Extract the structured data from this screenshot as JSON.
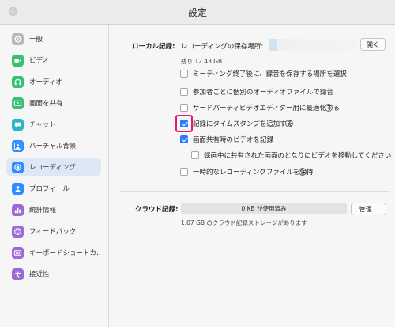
{
  "window": {
    "title": "設定"
  },
  "sidebar": {
    "items": [
      {
        "label": "一般",
        "icon": "gear-icon",
        "color": "#b9b9b9",
        "active": false
      },
      {
        "label": "ビデオ",
        "icon": "video-icon",
        "color": "#38c173",
        "active": false
      },
      {
        "label": "オーディオ",
        "icon": "headphones-icon",
        "color": "#38c173",
        "active": false
      },
      {
        "label": "画面を共有",
        "icon": "share-screen-icon",
        "color": "#38c173",
        "active": false
      },
      {
        "label": "チャット",
        "icon": "chat-icon",
        "color": "#2bb6c8",
        "active": false
      },
      {
        "label": "バーチャル背景",
        "icon": "person-background-icon",
        "color": "#2d8cff",
        "active": false
      },
      {
        "label": "レコーディング",
        "icon": "record-icon",
        "color": "#2d8cff",
        "active": true
      },
      {
        "label": "プロフィール",
        "icon": "profile-icon",
        "color": "#2d8cff",
        "active": false
      },
      {
        "label": "統計情報",
        "icon": "stats-icon",
        "color": "#9b6ad6",
        "active": false
      },
      {
        "label": "フィードバック",
        "icon": "feedback-icon",
        "color": "#9b6ad6",
        "active": false
      },
      {
        "label": "キーボードショートカ…",
        "icon": "keyboard-icon",
        "color": "#9b6ad6",
        "active": false
      },
      {
        "label": "接近性",
        "icon": "accessibility-icon",
        "color": "#9b6ad6",
        "active": false
      }
    ]
  },
  "local": {
    "label": "ローカル記録:",
    "location_label": "レコーディングの保存場所:",
    "open_button": "開く",
    "remaining": "残り 12.43 GB",
    "options": [
      {
        "label": "ミーティング終了後に、録音を保存する場所を選択",
        "checked": false,
        "help": false
      },
      {
        "label": "参加者ごとに個別のオーディオファイルで録音",
        "checked": false,
        "help": false
      },
      {
        "label": "サードパーティビデオエディター用に最適化する",
        "checked": false,
        "help": true
      },
      {
        "label": "記録にタイムスタンプを追加する",
        "checked": true,
        "help": true
      },
      {
        "label": "画面共有時のビデオを記録",
        "checked": true,
        "help": false
      },
      {
        "label": "録画中に共有された画面のとなりにビデオを移動してください",
        "checked": false,
        "help": false
      },
      {
        "label": "一時的なレコーディングファイルを保持",
        "checked": false,
        "help": true
      }
    ]
  },
  "cloud": {
    "label": "クラウド記録:",
    "usage_text": "0 KB が使用済み",
    "used_fraction": 0,
    "manage_button": "管理...",
    "storage_text": "1.07 GB のクラウド記録ストレージがあります"
  },
  "colors": {
    "accent": "#2b7bff",
    "highlight": "#e8196e"
  }
}
